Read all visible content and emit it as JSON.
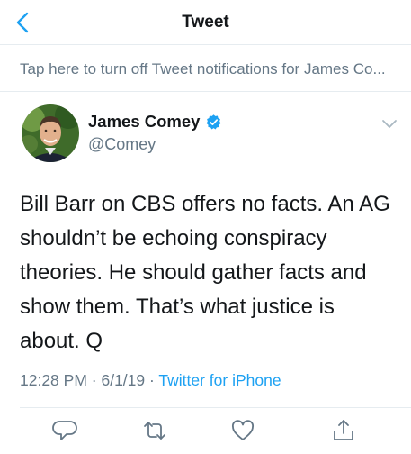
{
  "nav": {
    "title": "Tweet"
  },
  "notification": {
    "text": "Tap here to turn off Tweet notifications for James Co..."
  },
  "author": {
    "name": "James Comey",
    "handle": "@Comey",
    "verified": true
  },
  "tweet": {
    "text": "Bill Barr on CBS offers no facts. An AG shouldn’t be echoing conspiracy theories. He should gather facts and show them. That’s what justice is about. Q"
  },
  "meta": {
    "time": "12:28 PM",
    "date": "6/1/19",
    "source": "Twitter for iPhone",
    "separator": "·"
  },
  "actions": [
    "reply-icon",
    "retweet-icon",
    "like-icon",
    "share-icon"
  ],
  "colors": {
    "accent": "#1da1f2",
    "secondary_text": "#657786",
    "divider": "#e6ecf0"
  }
}
